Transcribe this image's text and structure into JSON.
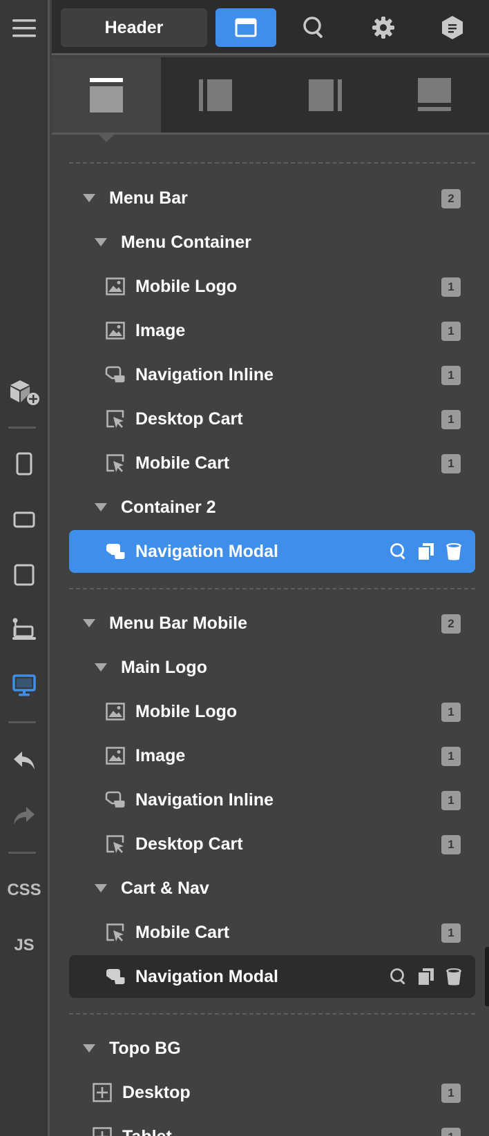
{
  "toolbar": {
    "header_label": "Header",
    "icons": [
      "layout-icon",
      "search-icon",
      "gear-icon",
      "hexagon-badge-icon"
    ]
  },
  "rail": {
    "css_label": "CSS",
    "js_label": "JS"
  },
  "tree": {
    "groups": [
      {
        "title": "Menu Bar",
        "count": "2",
        "children": [
          {
            "title": "Menu Container",
            "items": [
              {
                "label": "Mobile Logo",
                "icon": "image-icon",
                "count": "1"
              },
              {
                "label": "Image",
                "icon": "image-icon",
                "count": "1"
              },
              {
                "label": "Navigation Inline",
                "icon": "navigation-icon",
                "count": "1"
              },
              {
                "label": "Desktop Cart",
                "icon": "cart-pointer-icon",
                "count": "1"
              },
              {
                "label": "Mobile Cart",
                "icon": "cart-pointer-icon",
                "count": "1"
              }
            ]
          },
          {
            "title": "Container 2",
            "items": [
              {
                "label": "Navigation Modal",
                "icon": "navigation-icon",
                "state": "selected"
              }
            ]
          }
        ]
      },
      {
        "title": "Menu Bar Mobile",
        "count": "2",
        "children": [
          {
            "title": "Main Logo",
            "items": [
              {
                "label": "Mobile Logo",
                "icon": "image-icon",
                "count": "1"
              },
              {
                "label": "Image",
                "icon": "image-icon",
                "count": "1"
              },
              {
                "label": "Navigation Inline",
                "icon": "navigation-icon",
                "count": "1"
              },
              {
                "label": "Desktop Cart",
                "icon": "cart-pointer-icon",
                "count": "1"
              }
            ]
          },
          {
            "title": "Cart & Nav",
            "items": [
              {
                "label": "Mobile Cart",
                "icon": "cart-pointer-icon",
                "count": "1"
              },
              {
                "label": "Navigation Modal",
                "icon": "navigation-icon",
                "state": "hover"
              }
            ]
          }
        ]
      },
      {
        "title": "Topo BG",
        "items": [
          {
            "label": "Desktop",
            "icon": "plus-box-icon",
            "count": "1"
          },
          {
            "label": "Tablet",
            "icon": "plus-box-icon",
            "count": "1"
          }
        ]
      }
    ]
  }
}
